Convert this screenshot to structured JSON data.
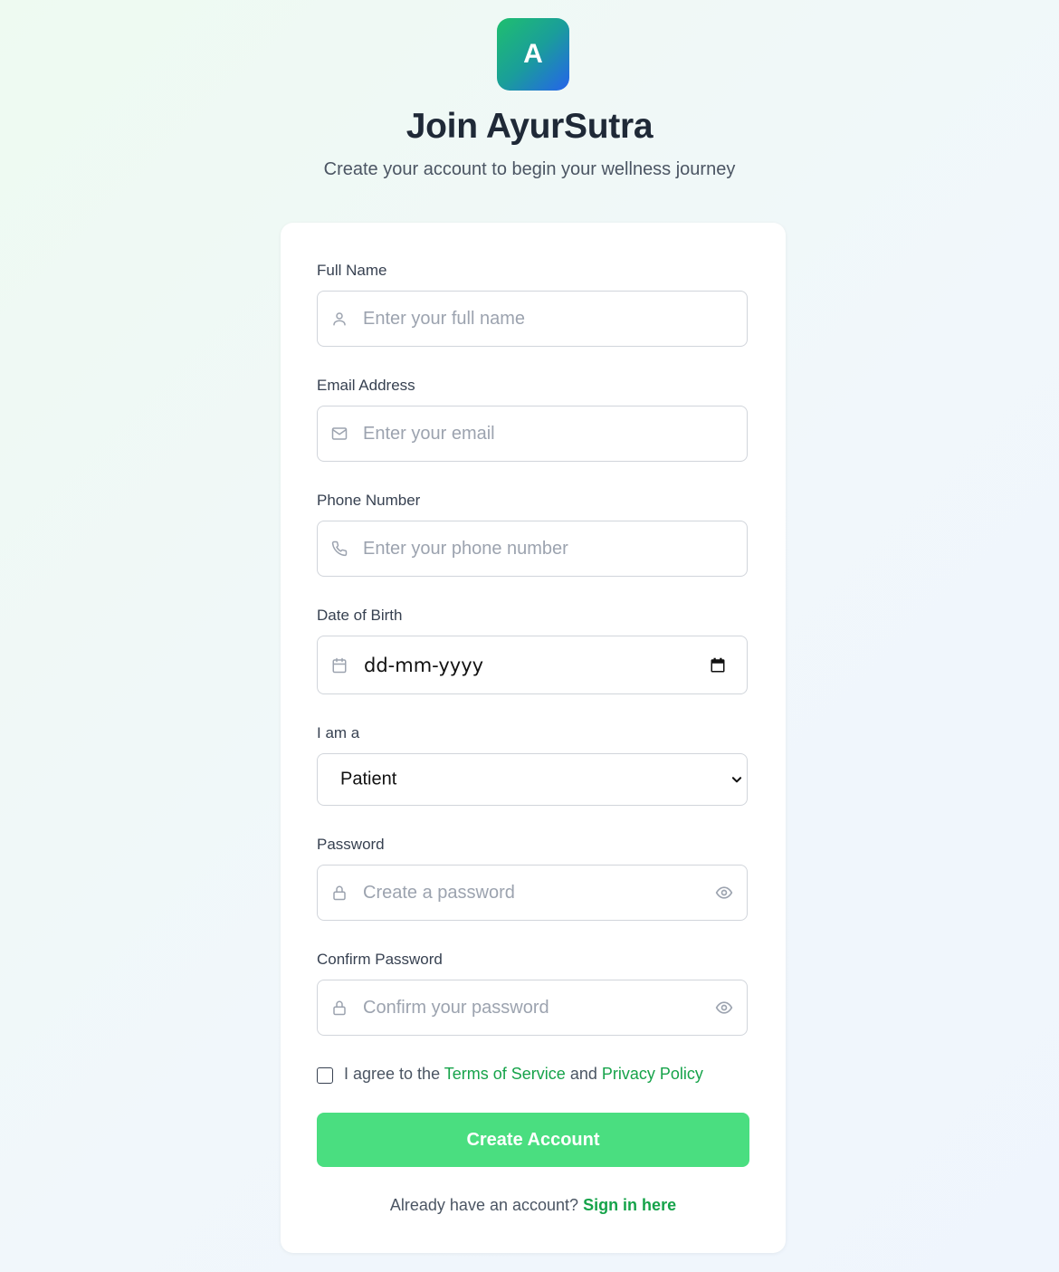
{
  "header": {
    "logo_letter": "A",
    "title": "Join AyurSutra",
    "subtitle": "Create your account to begin your wellness journey"
  },
  "form": {
    "full_name": {
      "label": "Full Name",
      "placeholder": "Enter your full name",
      "icon": "user-icon"
    },
    "email": {
      "label": "Email Address",
      "placeholder": "Enter your email",
      "icon": "mail-icon"
    },
    "phone": {
      "label": "Phone Number",
      "placeholder": "Enter your phone number",
      "icon": "phone-icon"
    },
    "dob": {
      "label": "Date of Birth",
      "value": "dd-mm-yyyy",
      "icon": "calendar-icon"
    },
    "role": {
      "label": "I am a",
      "selected": "Patient"
    },
    "password": {
      "label": "Password",
      "placeholder": "Create a password",
      "icon": "lock-icon"
    },
    "confirm_password": {
      "label": "Confirm Password",
      "placeholder": "Confirm your password",
      "icon": "lock-icon"
    },
    "terms": {
      "prefix": "I agree to the",
      "terms_link": "Terms of Service",
      "and": "and",
      "privacy_link": "Privacy Policy"
    },
    "submit_label": "Create Account"
  },
  "footer": {
    "text": "Already have an account?",
    "link": "Sign in here"
  },
  "colors": {
    "accent": "#16a34a",
    "button": "#4ade80",
    "logo_gradient_start": "#1fbf6e",
    "logo_gradient_end": "#2563eb"
  }
}
